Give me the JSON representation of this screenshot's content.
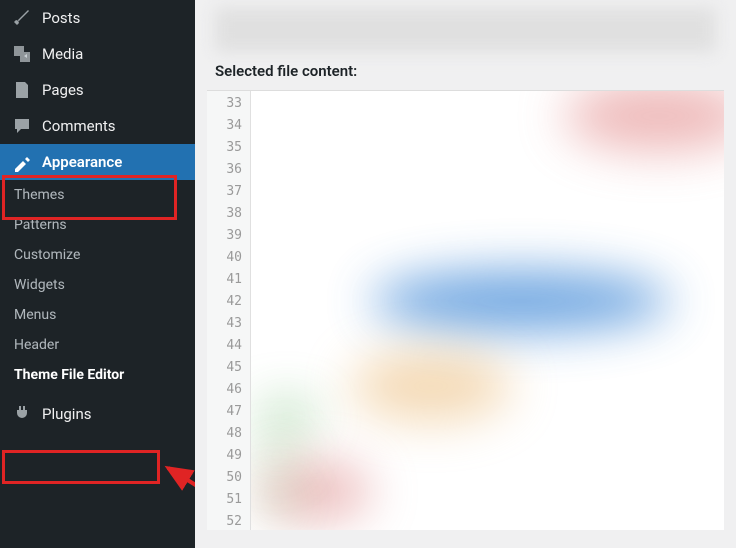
{
  "sidebar": {
    "items": {
      "posts": {
        "label": "Posts"
      },
      "media": {
        "label": "Media"
      },
      "pages": {
        "label": "Pages"
      },
      "comments": {
        "label": "Comments"
      },
      "appearance": {
        "label": "Appearance"
      },
      "plugins": {
        "label": "Plugins"
      }
    },
    "appearance_submenu": {
      "themes": "Themes",
      "patterns": "Patterns",
      "customize": "Customize",
      "widgets": "Widgets",
      "menus": "Menus",
      "header": "Header",
      "theme_file_editor": "Theme File Editor"
    }
  },
  "content": {
    "selected_file_label": "Selected file content:",
    "line_start": 33,
    "line_end": 52
  }
}
